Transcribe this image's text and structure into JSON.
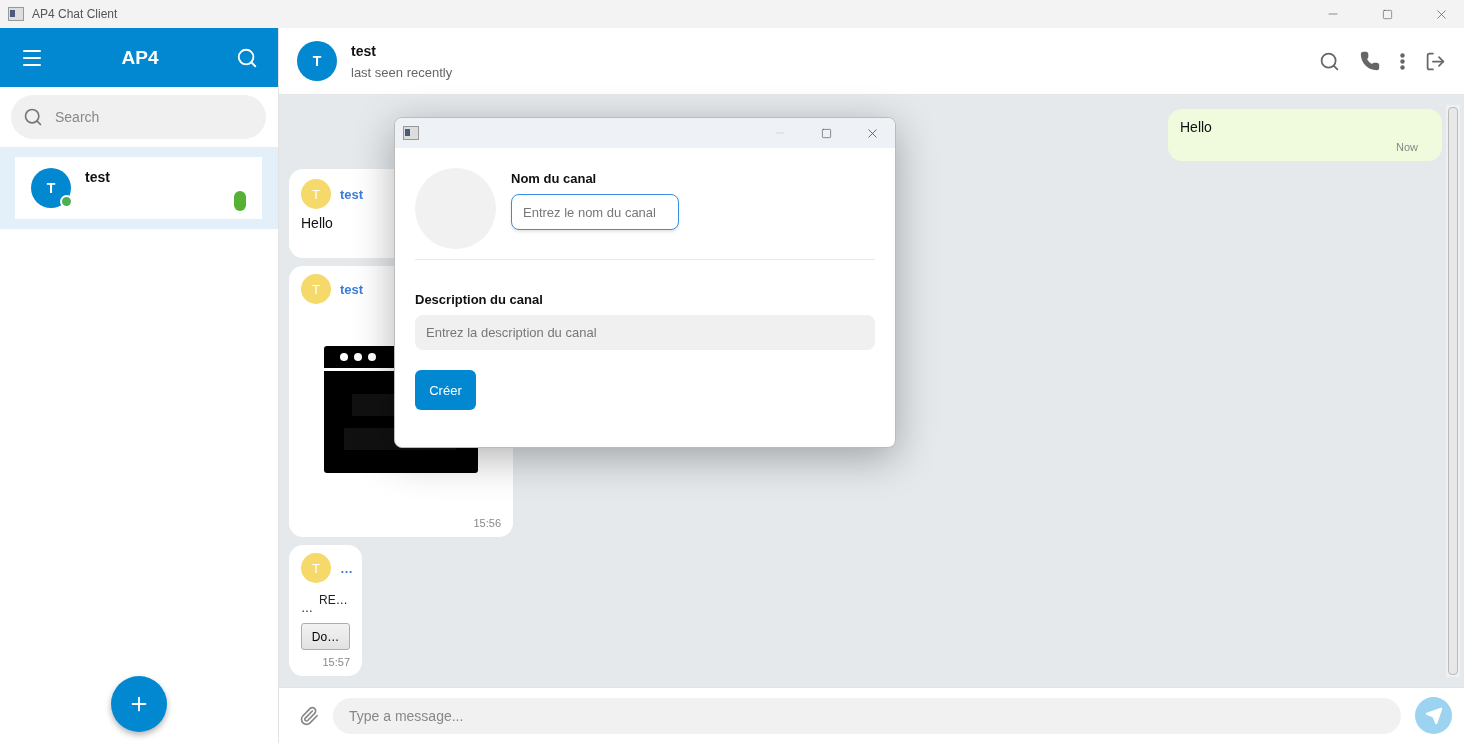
{
  "window": {
    "title": "AP4 Chat Client"
  },
  "sidebar": {
    "title": "AP4",
    "search": {
      "placeholder": "Search"
    },
    "chats": [
      {
        "avatar": "T",
        "name": "test",
        "online": true,
        "selected": true,
        "unread": true
      }
    ]
  },
  "chat": {
    "avatar": "T",
    "name": "test",
    "status": "last seen recently",
    "messages": [
      {
        "kind": "text",
        "outgoing": true,
        "text": "Hello",
        "time": "Now"
      },
      {
        "kind": "text",
        "outgoing": false,
        "avatar": "T",
        "sender": "test",
        "text": "Hello"
      },
      {
        "outgoing": false,
        "avatar": "T",
        "sender": "test",
        "time": "15:56"
      },
      {
        "kind": "file",
        "outgoing": false,
        "avatar": "T",
        "sender": "…",
        "file_icon": "…",
        "file_name": "RE…",
        "button": "Do…",
        "time": "15:57"
      }
    ],
    "composer": {
      "placeholder": "Type a message..."
    }
  },
  "dialog": {
    "name_label": "Nom du canal",
    "name_placeholder": "Entrez le nom du canal",
    "description_label": "Description du canal",
    "description_placeholder": "Entrez la description du canal",
    "submit": "Créer"
  }
}
